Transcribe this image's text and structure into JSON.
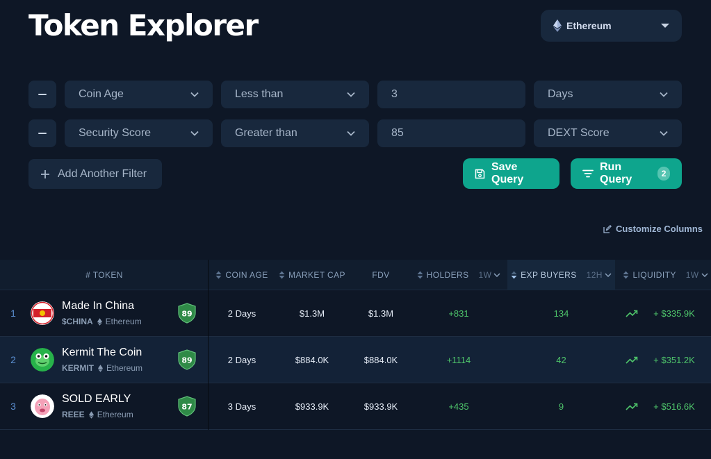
{
  "page": {
    "title": "Token Explorer"
  },
  "network": {
    "selected": "Ethereum"
  },
  "filters": [
    {
      "field": "Coin Age",
      "operator": "Less than",
      "value": "3",
      "unit": "Days"
    },
    {
      "field": "Security Score",
      "operator": "Greater than",
      "value": "85",
      "unit": "DEXT Score"
    }
  ],
  "actions": {
    "add_filter": "Add Another Filter",
    "save_query": "Save Query",
    "run_query": "Run Query",
    "run_query_count": "2",
    "customize_columns": "Customize Columns"
  },
  "table": {
    "headers": {
      "token": "# TOKEN",
      "coin_age": "COIN AGE",
      "market_cap": "MARKET CAP",
      "fdv": "FDV",
      "holders": "HOLDERS",
      "holders_period": "1W",
      "exp_buyers": "EXP BUYERS",
      "exp_buyers_period": "12H",
      "liquidity": "LIQUIDITY",
      "liquidity_period": "1W"
    },
    "rows": [
      {
        "rank": "1",
        "name": "Made In China",
        "symbol": "$CHINA",
        "chain": "Ethereum",
        "score": "89",
        "coin_age": "2 Days",
        "market_cap": "$1.3M",
        "fdv": "$1.3M",
        "holders": "+831",
        "exp_buyers": "134",
        "liquidity": "+ $335.9K",
        "logo": "china-flag-logo"
      },
      {
        "rank": "2",
        "name": "Kermit The Coin",
        "symbol": "KERMIT",
        "chain": "Ethereum",
        "score": "89",
        "coin_age": "2 Days",
        "market_cap": "$884.0K",
        "fdv": "$884.0K",
        "holders": "+1114",
        "exp_buyers": "42",
        "liquidity": "+ $351.2K",
        "logo": "frog-logo"
      },
      {
        "rank": "3",
        "name": "SOLD EARLY",
        "symbol": "REEE",
        "chain": "Ethereum",
        "score": "87",
        "coin_age": "3 Days",
        "market_cap": "$933.9K",
        "fdv": "$933.9K",
        "holders": "+435",
        "exp_buyers": "9",
        "liquidity": "+ $516.6K",
        "logo": "pink-face-logo"
      }
    ]
  },
  "colors": {
    "background": "#0e1726",
    "control": "#18283d",
    "accent": "#0ea58d",
    "positive": "#4ec46a",
    "score_badge": "#2f8a47"
  }
}
